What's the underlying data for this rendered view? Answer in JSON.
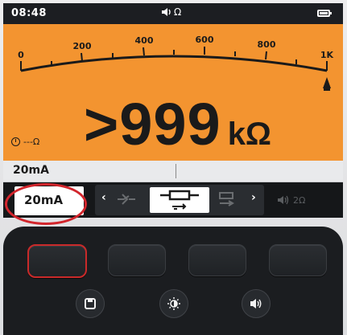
{
  "status": {
    "time": "08:48",
    "mode_indicator": "Ω"
  },
  "scale": {
    "ticks": [
      "0",
      "200",
      "400",
      "600",
      "800",
      "1K"
    ]
  },
  "reading": {
    "value": ">999",
    "unit": "kΩ",
    "aux_value": "---Ω"
  },
  "info": {
    "test_current": "20mA"
  },
  "softkeys": {
    "left_label": "20mA",
    "right_label": "2Ω"
  },
  "annotation": {
    "color": "#d2252c"
  },
  "colors": {
    "display_bg": "#f39430",
    "status_bg": "#1c1e22",
    "accent_red": "#c92a2a"
  },
  "icons": {
    "buzzer": "speaker-icon",
    "save": "save-icon",
    "brightness": "brightness-icon",
    "sound": "sound-icon"
  }
}
